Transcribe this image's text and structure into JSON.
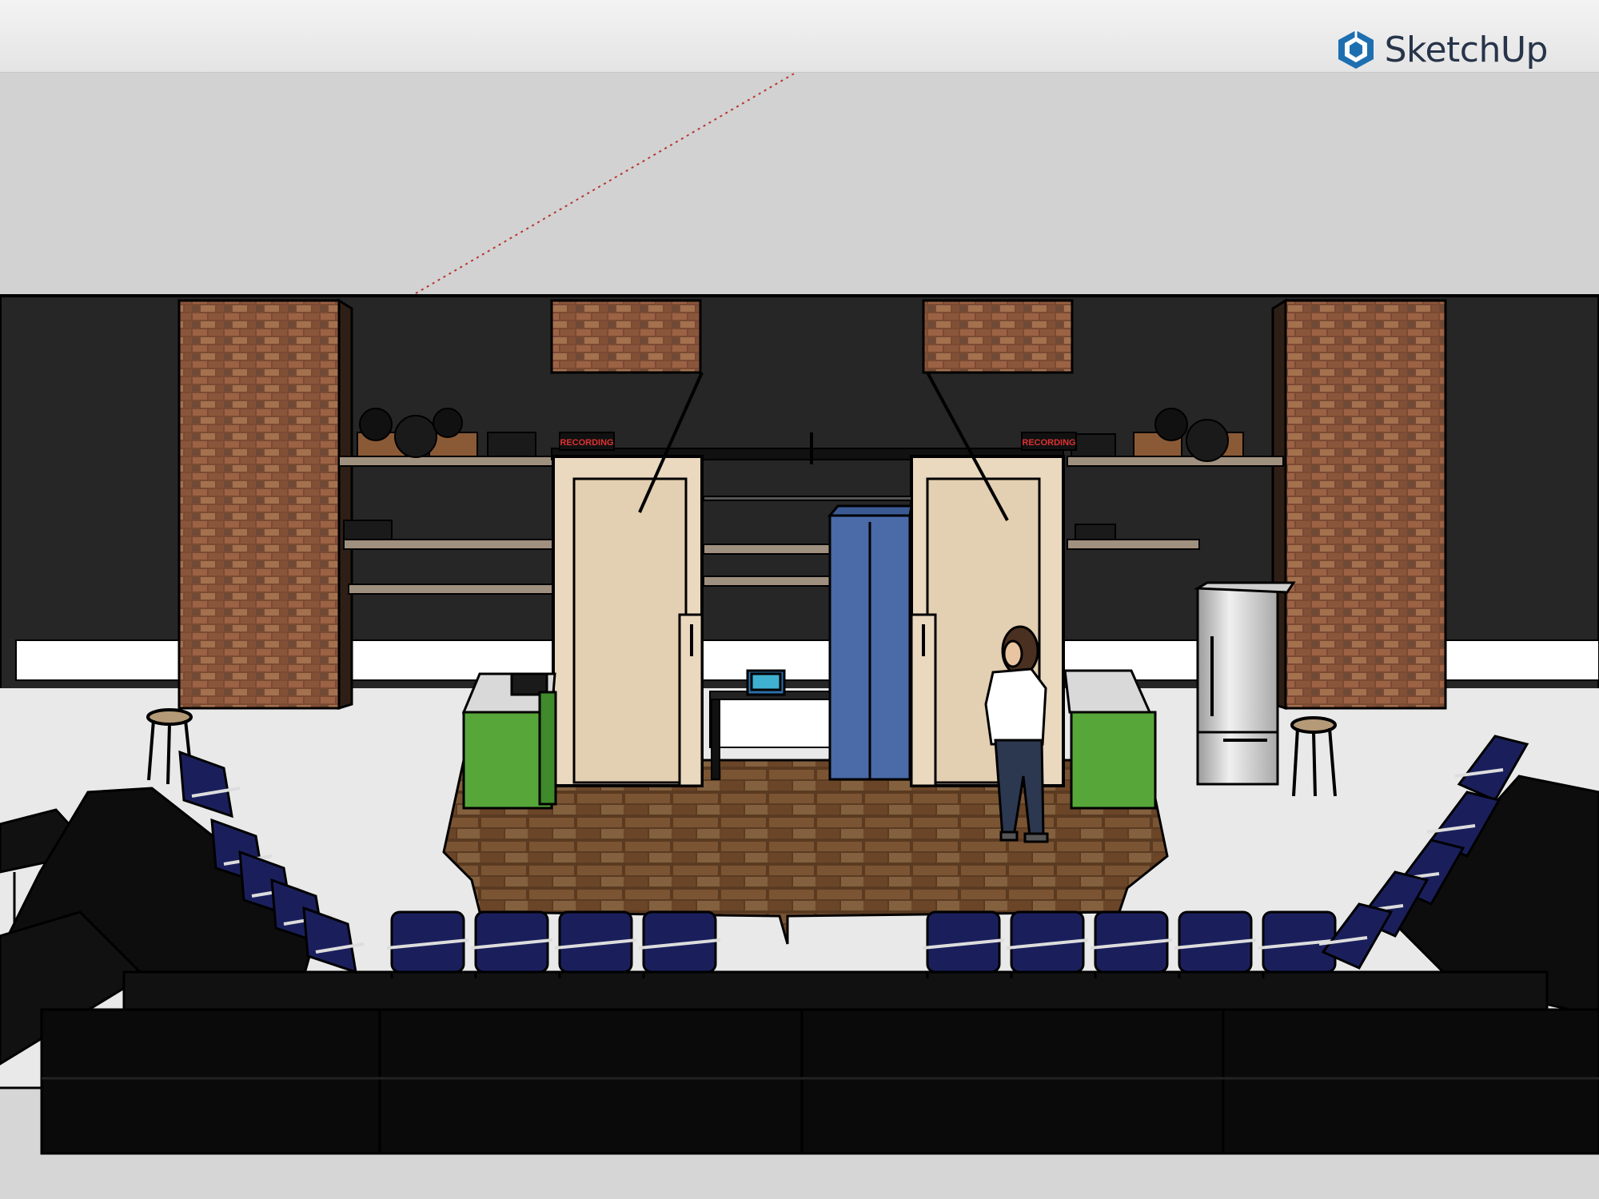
{
  "app": {
    "name": "SketchUp",
    "logo_icon": "sketchup-cube-icon"
  },
  "scene": {
    "description_labels": {
      "left_sign": "RECORDING",
      "right_sign": "RECORDING"
    },
    "colors": {
      "sky": "#d2d2d2",
      "back_wall": "#262626",
      "floor": "#e9e9e9",
      "wood_floor": "#6b4a2e",
      "brick": "#8a5a3c",
      "panel": "#e8d8c0",
      "blue_cabinet": "#4a6aa8",
      "green_counter": "#57a63a",
      "chair": "#1a1f5c",
      "sofa": "#0d0d0d",
      "sign": "#e03131"
    }
  }
}
